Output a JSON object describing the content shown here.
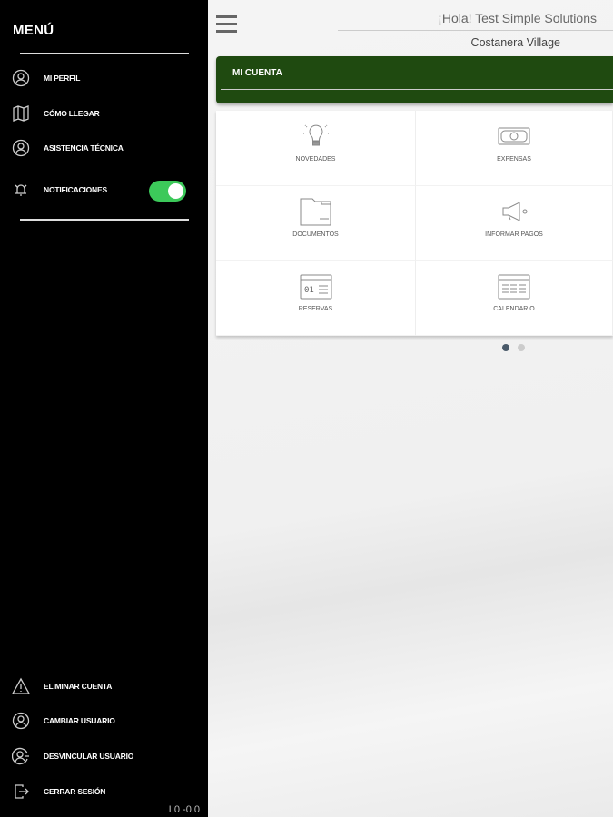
{
  "sidebar": {
    "title": "MENÚ",
    "items": [
      {
        "label": "MI PERFIL",
        "icon": "user-circle-icon"
      },
      {
        "label": "CÓMO LLEGAR",
        "icon": "map-icon"
      },
      {
        "label": "ASISTENCIA TÉCNICA",
        "icon": "user-circle-icon"
      },
      {
        "label": "NOTIFICACIONES",
        "icon": "bell-icon"
      }
    ],
    "notifications_on": true,
    "bottom_items": [
      {
        "label": "ELIMINAR CUENTA",
        "icon": "warning-icon"
      },
      {
        "label": "CAMBIAR USUARIO",
        "icon": "user-circle-icon"
      },
      {
        "label": "DESVINCULAR USUARIO",
        "icon": "user-unlink-icon"
      },
      {
        "label": "CERRAR SESIÓN",
        "icon": "logout-icon"
      }
    ],
    "version": "L0  -0.0"
  },
  "header": {
    "greeting": "¡Hola! Test Simple Solutions",
    "community": "Costanera Village"
  },
  "section": {
    "title": "MI CUENTA",
    "accent": "#1f4a10"
  },
  "tiles": [
    {
      "label": "NOVEDADES",
      "icon": "lightbulb-icon"
    },
    {
      "label": "EXPENSAS",
      "icon": "banknote-icon"
    },
    {
      "label": "DOCUMENTOS",
      "icon": "folder-icon"
    },
    {
      "label": "INFORMAR PAGOS",
      "icon": "megaphone-icon"
    },
    {
      "label": "RESERVAS",
      "icon": "calendar-day-icon",
      "day": "01"
    },
    {
      "label": "CALENDARIO",
      "icon": "calendar-icon"
    }
  ],
  "pager": {
    "pages": 2,
    "current": 1
  }
}
